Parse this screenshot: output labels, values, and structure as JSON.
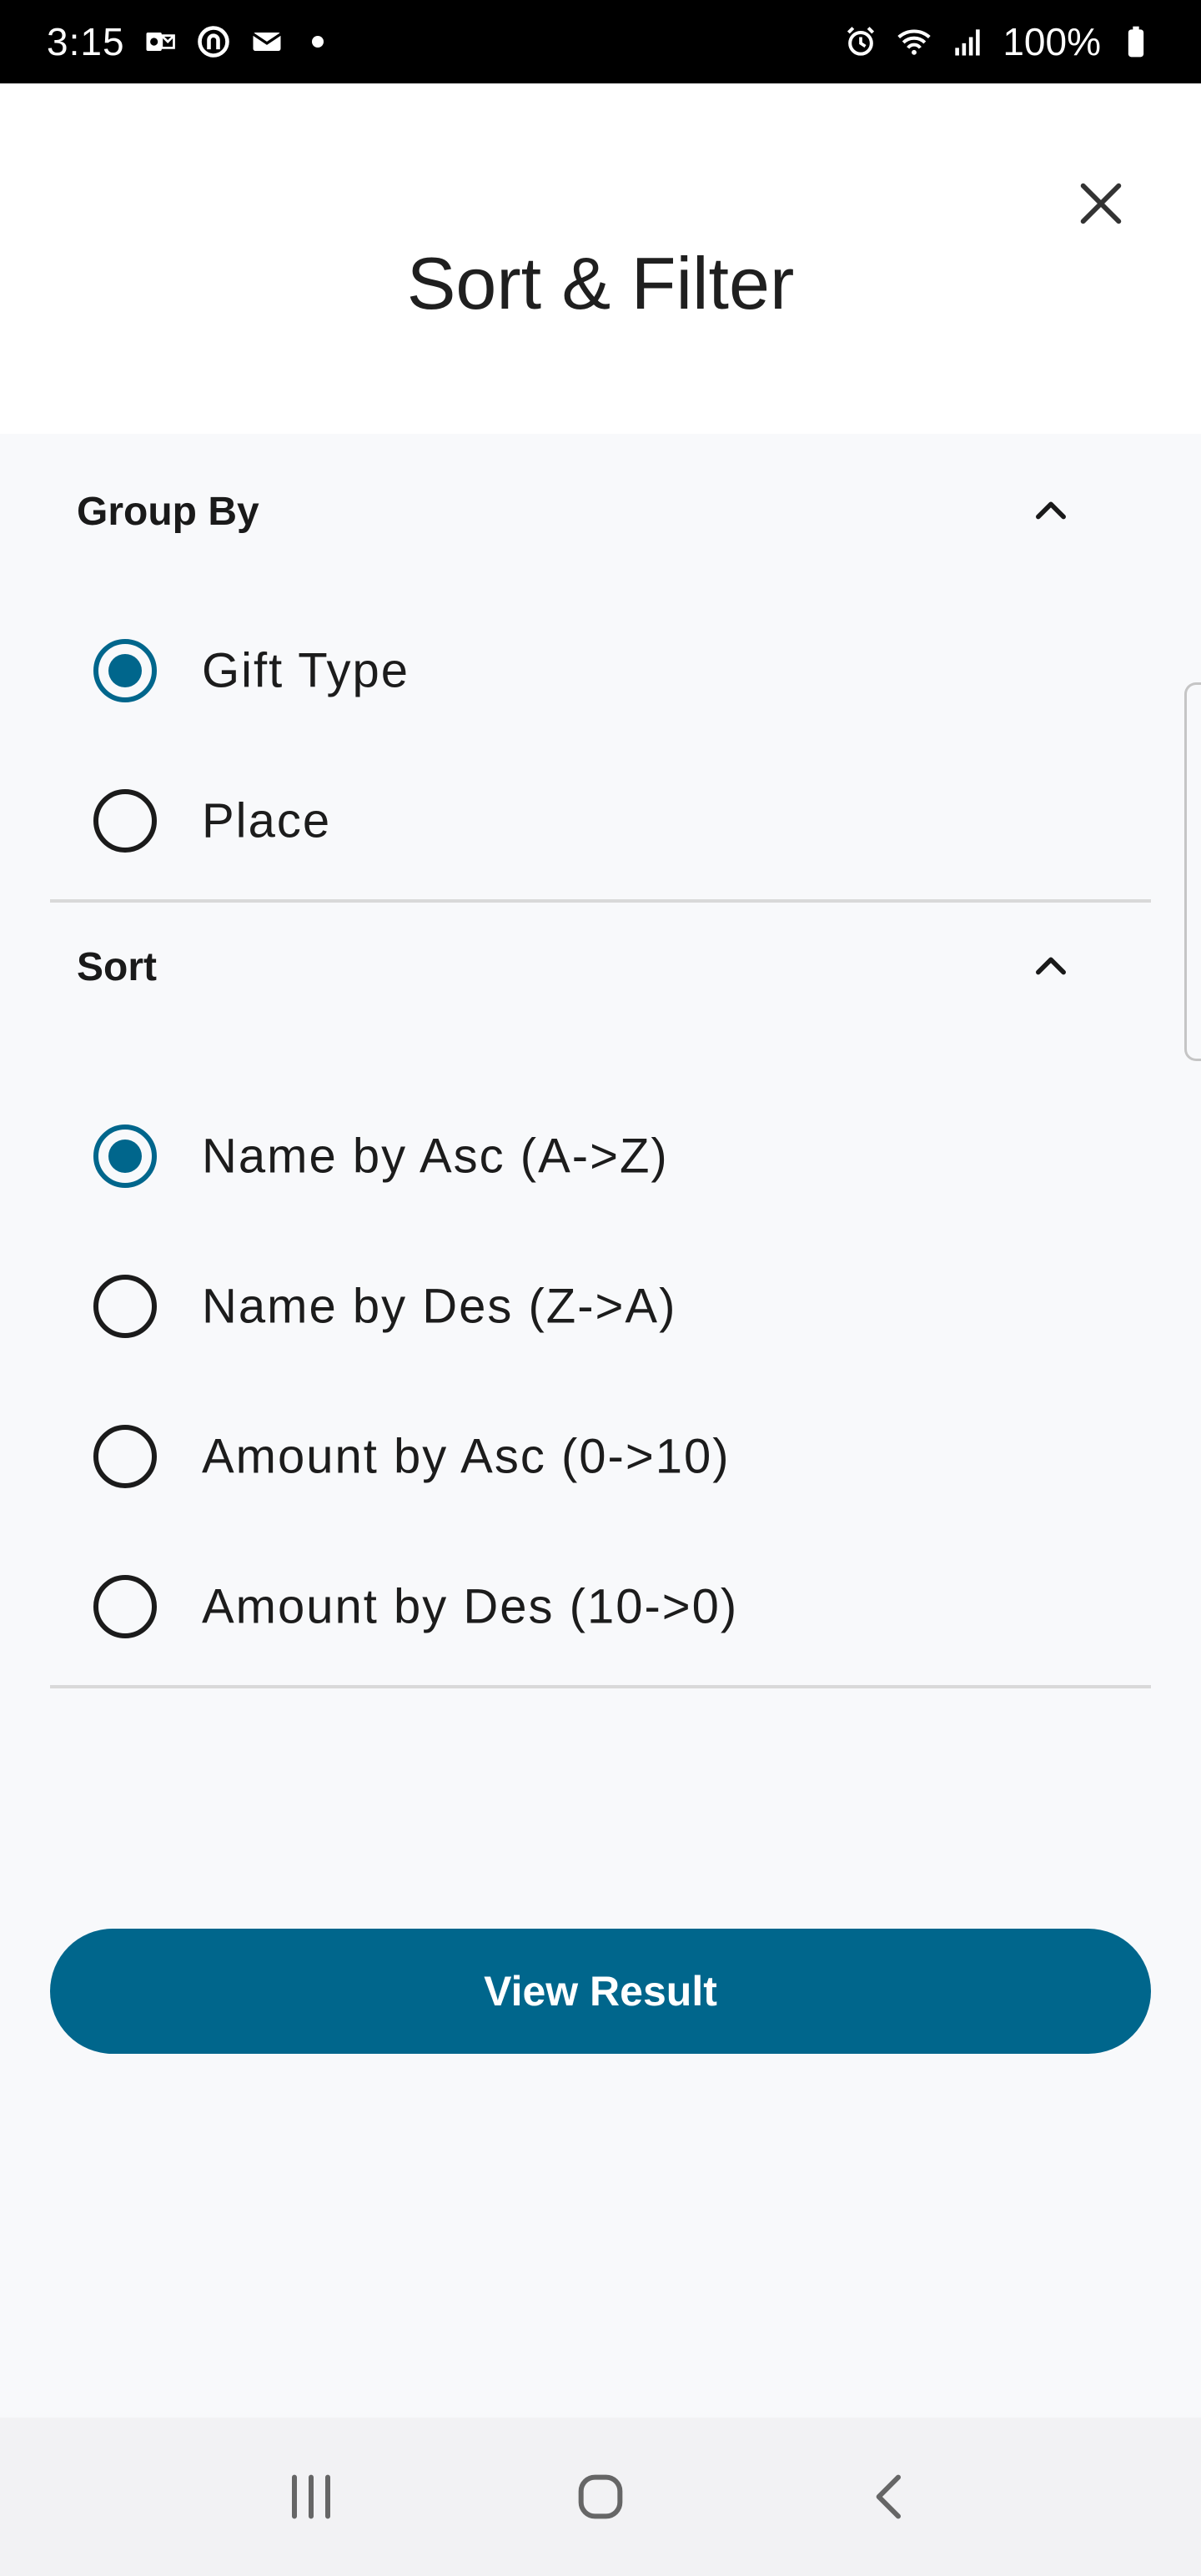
{
  "status_bar": {
    "time": "3:15",
    "battery": "100%"
  },
  "header": {
    "title": "Sort & Filter"
  },
  "group_by": {
    "title": "Group By",
    "options": [
      {
        "label": "Gift Type",
        "selected": true
      },
      {
        "label": "Place",
        "selected": false
      }
    ]
  },
  "sort": {
    "title": "Sort",
    "options": [
      {
        "label": "Name by Asc (A->Z)",
        "selected": true
      },
      {
        "label": "Name by Des (Z->A)",
        "selected": false
      },
      {
        "label": "Amount by Asc (0->10)",
        "selected": false
      },
      {
        "label": "Amount by Des (10->0)",
        "selected": false
      }
    ]
  },
  "actions": {
    "view_result_label": "View Result"
  },
  "colors": {
    "accent": "#00668c",
    "background": "#f8f9fb",
    "header_background": "#ffffff"
  },
  "icons": {
    "close": "close-icon",
    "chevron": "chevron-up-icon",
    "nav_recent": "recent-apps-icon",
    "nav_home": "home-icon",
    "nav_back": "back-icon"
  }
}
